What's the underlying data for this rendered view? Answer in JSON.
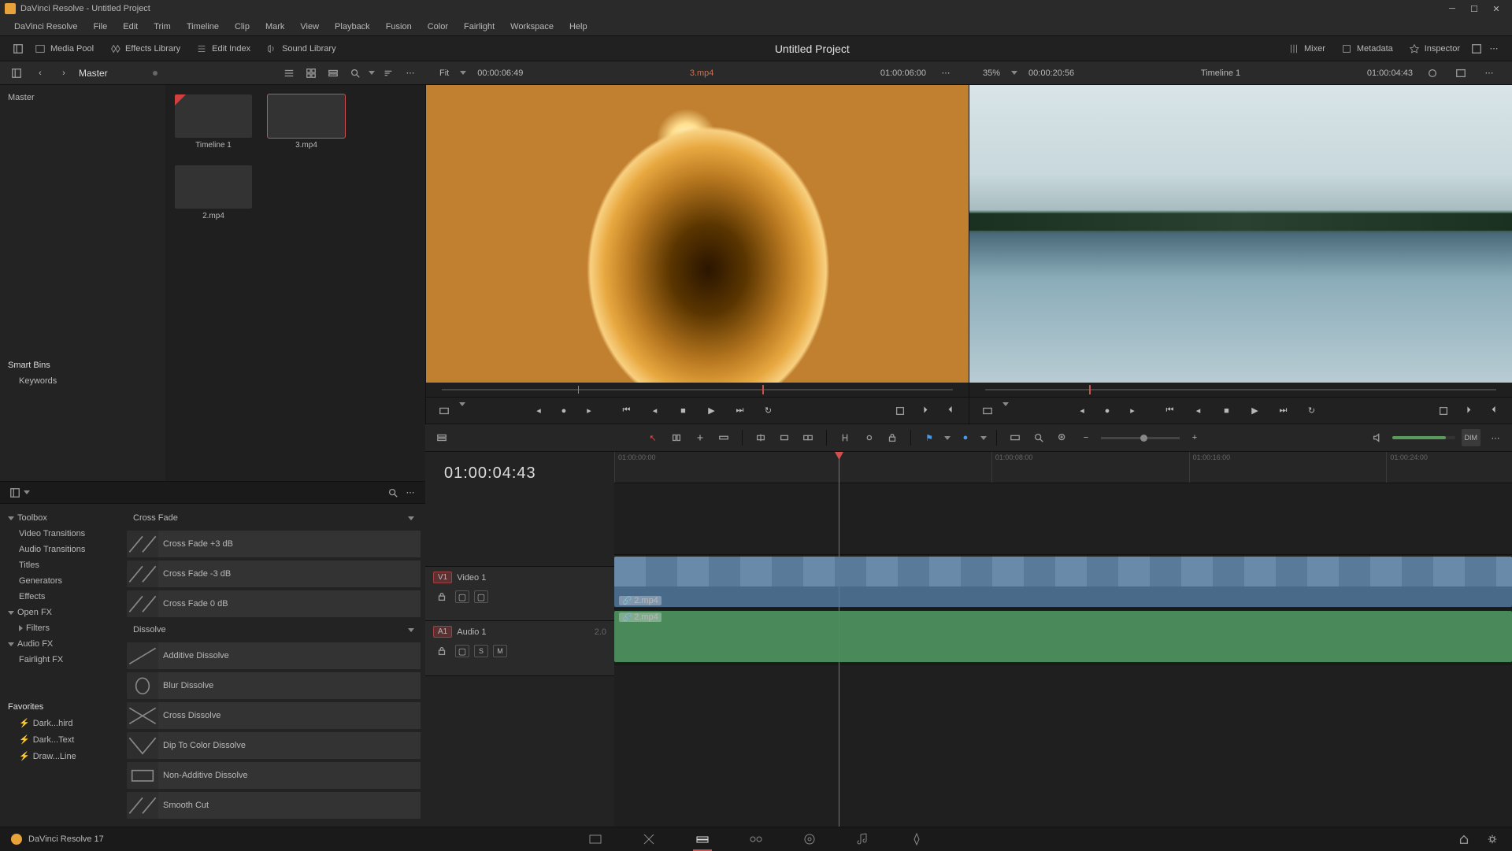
{
  "title": "DaVinci Resolve - Untitled Project",
  "menus": [
    "DaVinci Resolve",
    "File",
    "Edit",
    "Trim",
    "Timeline",
    "Clip",
    "Mark",
    "View",
    "Playback",
    "Fusion",
    "Color",
    "Fairlight",
    "Workspace",
    "Help"
  ],
  "toolbar": {
    "media_pool": "Media Pool",
    "effects_library": "Effects Library",
    "edit_index": "Edit Index",
    "sound_library": "Sound Library",
    "project": "Untitled Project",
    "mixer": "Mixer",
    "metadata": "Metadata",
    "inspector": "Inspector"
  },
  "pool_header": {
    "master": "Master"
  },
  "source_header": {
    "fit": "Fit",
    "tc_left": "00:00:06:49",
    "clip": "3.mp4",
    "tc_right": "01:00:06:00",
    "zoom": "35%",
    "prog_tc": "00:00:20:56",
    "timeline": "Timeline 1",
    "prog_right": "01:00:04:43"
  },
  "tree": {
    "master": "Master",
    "smart_bins": "Smart Bins",
    "keywords": "Keywords"
  },
  "clips": [
    {
      "name": "Timeline 1",
      "kind": "timeline"
    },
    {
      "name": "3.mp4",
      "kind": "white",
      "selected": true
    },
    {
      "name": "2.mp4",
      "kind": "lake"
    }
  ],
  "effects": {
    "toolbox": "Toolbox",
    "cats": {
      "video_trans": "Video Transitions",
      "audio_trans": "Audio Transitions",
      "titles": "Titles",
      "generators": "Generators",
      "effects": "Effects",
      "open_fx": "Open FX",
      "filters": "Filters",
      "audio_fx": "Audio FX",
      "fairlight_fx": "Fairlight FX",
      "favorites": "Favorites",
      "fav1": "Dark...hird",
      "fav2": "Dark...Text",
      "fav3": "Draw...Line"
    },
    "group_crossfade": "Cross Fade",
    "crossfade_items": [
      "Cross Fade +3 dB",
      "Cross Fade -3 dB",
      "Cross Fade 0 dB"
    ],
    "group_dissolve": "Dissolve",
    "dissolve_items": [
      "Additive Dissolve",
      "Blur Dissolve",
      "Cross Dissolve",
      "Dip To Color Dissolve",
      "Non-Additive Dissolve",
      "Smooth Cut"
    ]
  },
  "timeline": {
    "timecode": "01:00:04:43",
    "ticks": [
      "01:00:00:00",
      "01:00:08:00",
      "01:00:16:00",
      "01:00:24:00"
    ],
    "v1": "V1",
    "video1": "Video 1",
    "a1": "A1",
    "audio1": "Audio 1",
    "a_ch": "2.0",
    "clip_name": "2.mp4"
  },
  "footer": {
    "app": "DaVinci Resolve 17"
  }
}
